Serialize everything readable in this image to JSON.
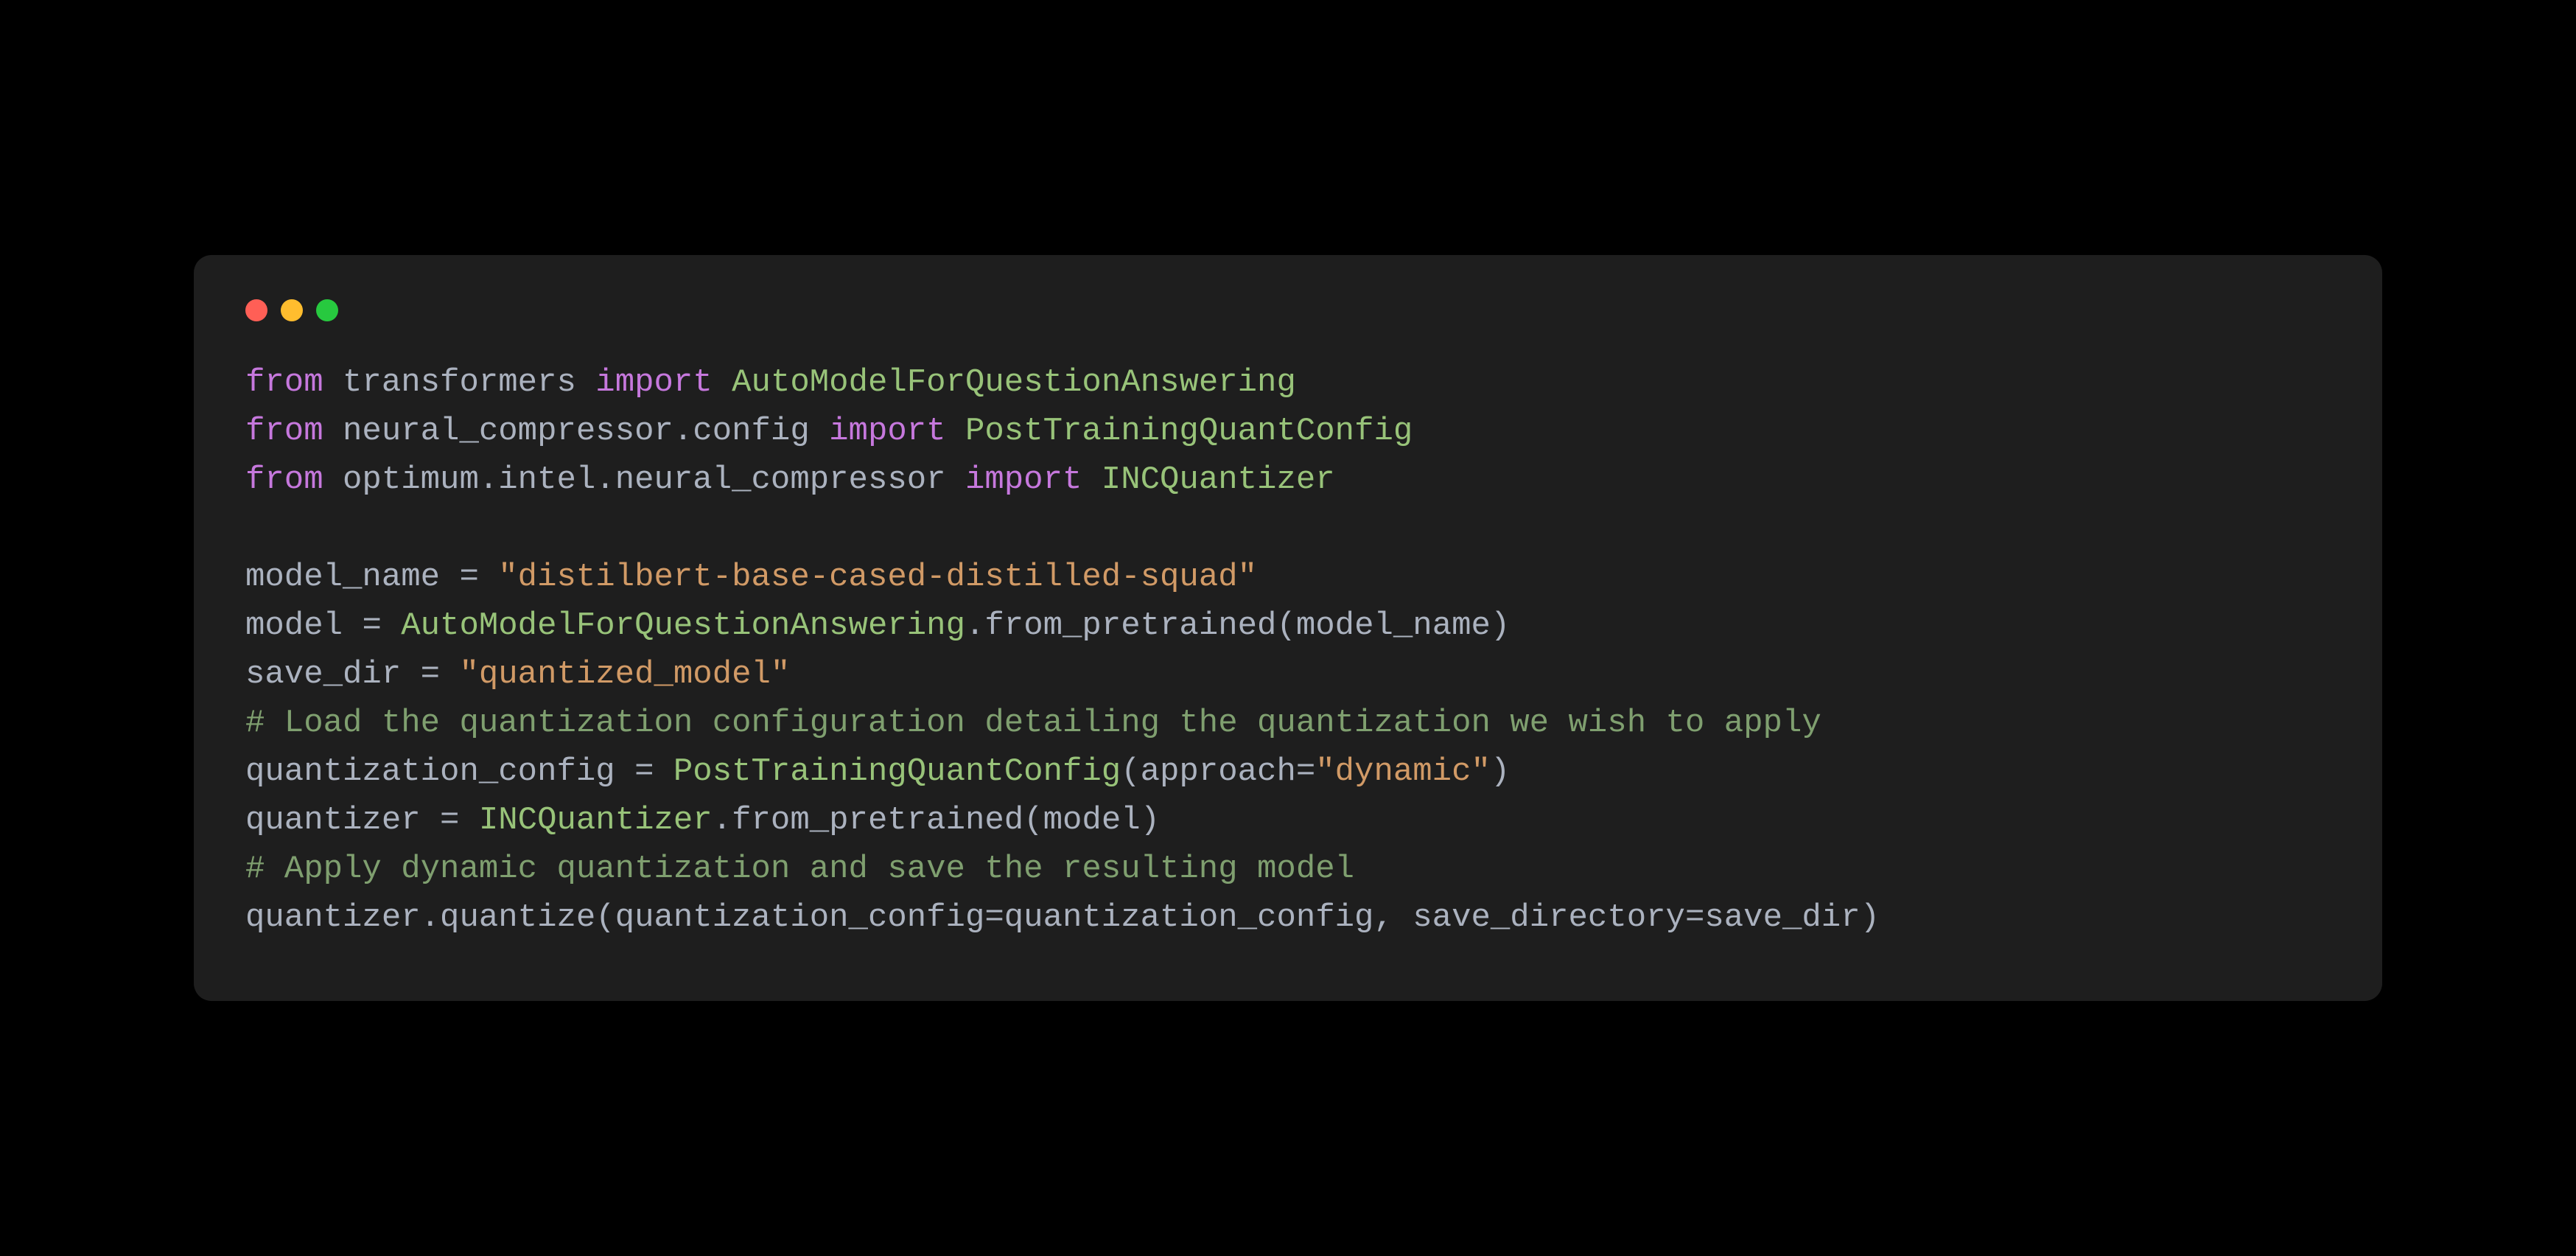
{
  "code": {
    "line1": {
      "kw1": "from",
      "mod": " transformers ",
      "kw2": "import",
      "cls": " AutoModelForQuestionAnswering"
    },
    "line2": {
      "kw1": "from",
      "mod": " neural_compressor.config ",
      "kw2": "import",
      "cls": " PostTrainingQuantConfig"
    },
    "line3": {
      "kw1": "from",
      "mod": " optimum.intel.neural_compressor ",
      "kw2": "import",
      "cls": " INCQuantizer"
    },
    "line4": "",
    "line5": {
      "var": "model_name ",
      "op": "=",
      "str": " \"distilbert-base-cased-distilled-squad\""
    },
    "line6": {
      "var1": "model ",
      "op": "=",
      "cls": " AutoModelForQuestionAnswering",
      "dot": ".",
      "fn": "from_pretrained",
      "p1": "(",
      "arg": "model_name",
      "p2": ")"
    },
    "line7": {
      "var": "save_dir ",
      "op": "=",
      "str": " \"quantized_model\""
    },
    "line8": {
      "cmt": "# Load the quantization configuration detailing the quantization we wish to apply"
    },
    "line9": {
      "var1": "quantization_config ",
      "op": "=",
      "cls": " PostTrainingQuantConfig",
      "p1": "(",
      "arg1": "approach",
      "eq": "=",
      "str": "\"dynamic\"",
      "p2": ")"
    },
    "line10": {
      "var1": "quantizer ",
      "op": "=",
      "cls": " INCQuantizer",
      "dot": ".",
      "fn": "from_pretrained",
      "p1": "(",
      "arg": "model",
      "p2": ")"
    },
    "line11": {
      "cmt": "# Apply dynamic quantization and save the resulting model"
    },
    "line12": {
      "obj": "quantizer",
      "dot": ".",
      "fn": "quantize",
      "p1": "(",
      "arg1": "quantization_config",
      "eq1": "=",
      "val1": "quantization_config",
      "comma": ", ",
      "arg2": "save_directory",
      "eq2": "=",
      "val2": "save_dir",
      "p2": ")"
    }
  }
}
